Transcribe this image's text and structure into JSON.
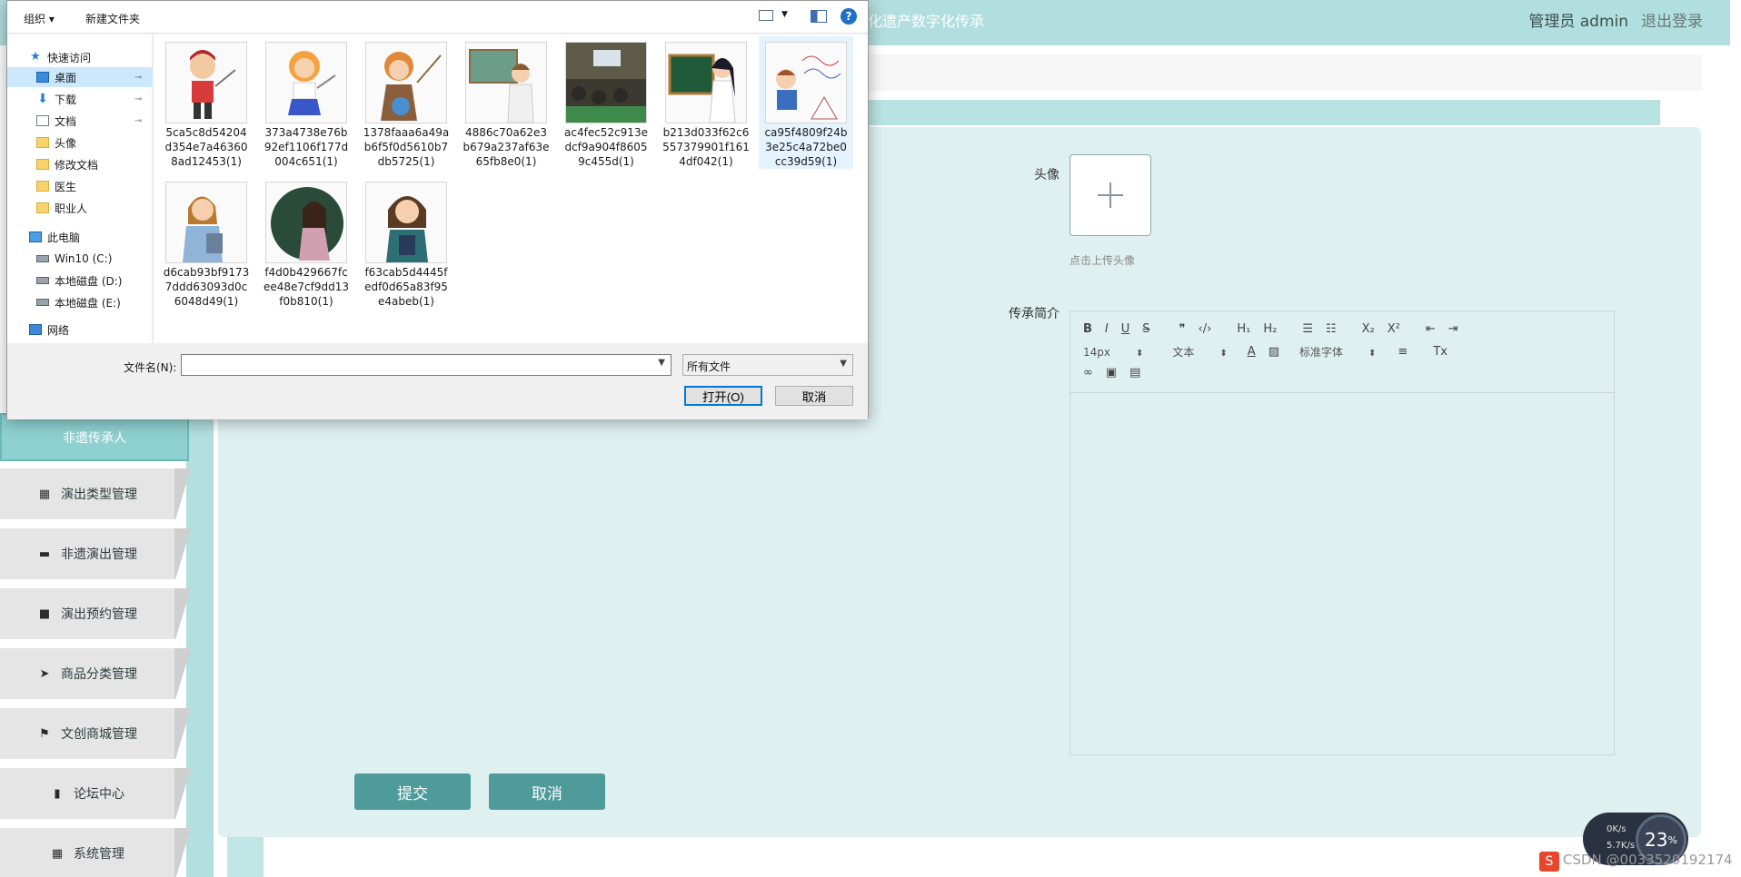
{
  "app": {
    "site_title": "化遗产数字化传承",
    "user_label": "管理员 admin",
    "logout": "退出登录"
  },
  "sidebar": {
    "active": "非遗传承人",
    "items": [
      {
        "label": "演出类型管理",
        "icon": "grid-icon"
      },
      {
        "label": "非遗演出管理",
        "icon": "chat-icon"
      },
      {
        "label": "演出预约管理",
        "icon": "video-icon"
      },
      {
        "label": "商品分类管理",
        "icon": "send-icon"
      },
      {
        "label": "文创商城管理",
        "icon": "flag-icon"
      },
      {
        "label": "论坛中心",
        "icon": "bar-chart-icon"
      },
      {
        "label": "系统管理",
        "icon": "grid-icon"
      }
    ]
  },
  "form": {
    "avatar_label": "头像",
    "avatar_hint": "点击上传头像",
    "intro_label": "传承简介",
    "submit": "提交",
    "cancel": "取消"
  },
  "editor": {
    "font_size": "14px",
    "text_type": "文本",
    "font_family": "标准字体"
  },
  "dialog": {
    "organize": "组织 ▾",
    "new_folder": "新建文件夹",
    "nav": {
      "quick_access": "快速访问",
      "desktop": "桌面",
      "downloads": "下载",
      "documents": "文档",
      "f1": "头像",
      "f2": "修改文档",
      "f3": "医生",
      "f4": "职业人",
      "this_pc": "此电脑",
      "drive_c": "Win10 (C:)",
      "drive_d": "本地磁盘 (D:)",
      "drive_e": "本地磁盘 (E:)",
      "network": "网络"
    },
    "files": [
      "5ca5c8d54204d354e7a463608ad12453(1)",
      "373a4738e76b92ef1106f177d004c651(1)",
      "1378faaa6a49ab6f5f0d5610b7db5725(1)",
      "4886c70a62e3b679a237af63e65fb8e0(1)",
      "ac4fec52c913edcf9a904f86059c455d(1)",
      "b213d033f62c6557379901f1614df042(1)",
      "ca95f4809f24b3e25c4a72be0cc39d59(1)",
      "d6cab93bf91737ddd63093d0c6048d49(1)",
      "f4d0b429667fcee48e7cf9dd13f0b810(1)",
      "f63cab5d4445fedf0d65a83f95e4abeb(1)"
    ],
    "filename_label": "文件名(N):",
    "filename_value": "",
    "filetype": "所有文件",
    "open": "打开(O)",
    "cancel": "取消"
  },
  "tray": {
    "up_speed": "0K/s",
    "down_speed": "5.7K/s",
    "percent": "23",
    "watermark": "CSDN @0033520192174"
  }
}
